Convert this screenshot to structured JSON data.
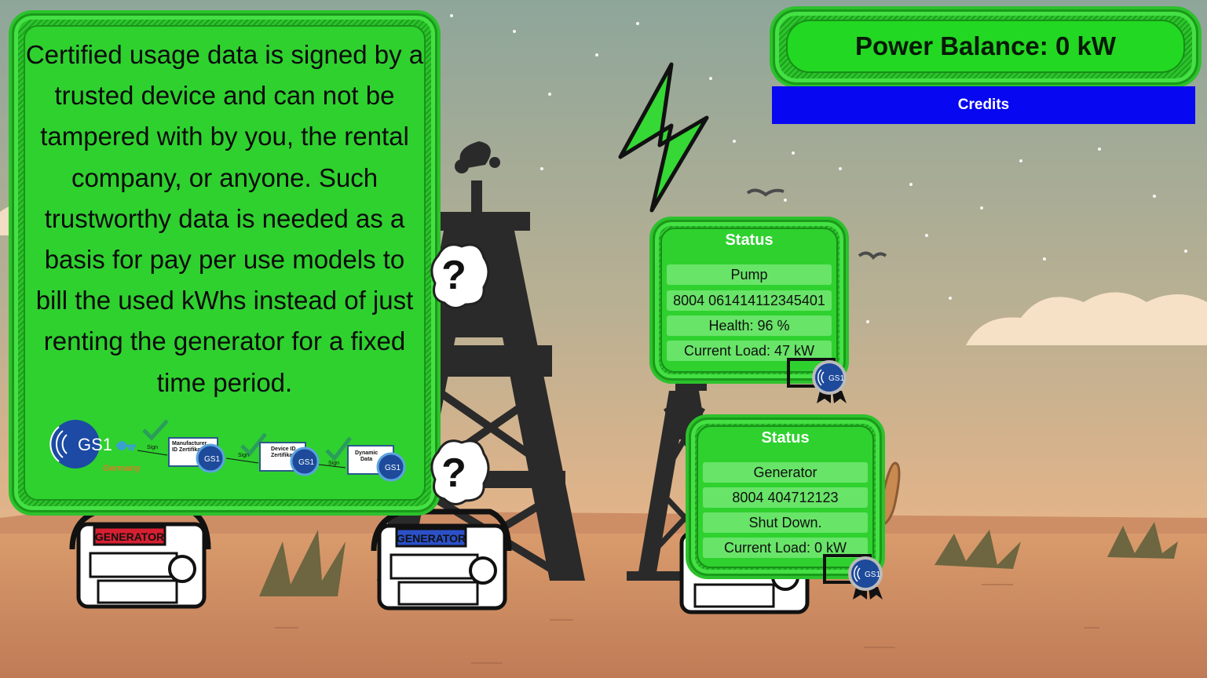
{
  "info": {
    "text": "Certified usage data is signed by a trusted device and can not be tampered with by you, the rental company, or anyone. Such trustworthy data is needed as a basis for pay per use models to bill the used kWhs instead of just renting the generator for a fixed time period."
  },
  "gs1_flow": {
    "brand": "GS1",
    "brand_sub": "Germany",
    "sign_label": "Sign",
    "step1": [
      "Manufacturer",
      "ID Zertifikat"
    ],
    "step2": [
      "Device ID",
      "Zertifikat"
    ],
    "step3": [
      "Dynamic",
      "Data"
    ],
    "badge_text": "GS1"
  },
  "balance": {
    "text": "Power Balance: 0 kW"
  },
  "credits": {
    "label": "Credits"
  },
  "pump_status": {
    "title": "Status",
    "rows": [
      "Pump",
      "8004 061414112345401",
      "Health: 96 %",
      "Current Load: 47 kW"
    ]
  },
  "generator_status": {
    "title": "Status",
    "rows": [
      "Generator",
      "8004 404712123",
      "Shut Down.",
      "Current Load: 0 kW"
    ]
  },
  "generators": {
    "label": "GENERATOR"
  },
  "help": {
    "symbol": "?"
  },
  "colors": {
    "panel_green": "#2fd12f",
    "credits_blue": "#0707f2",
    "sky_top": "#8fa59b",
    "sky_bottom": "#e9b184",
    "ground": "#c98a60"
  }
}
